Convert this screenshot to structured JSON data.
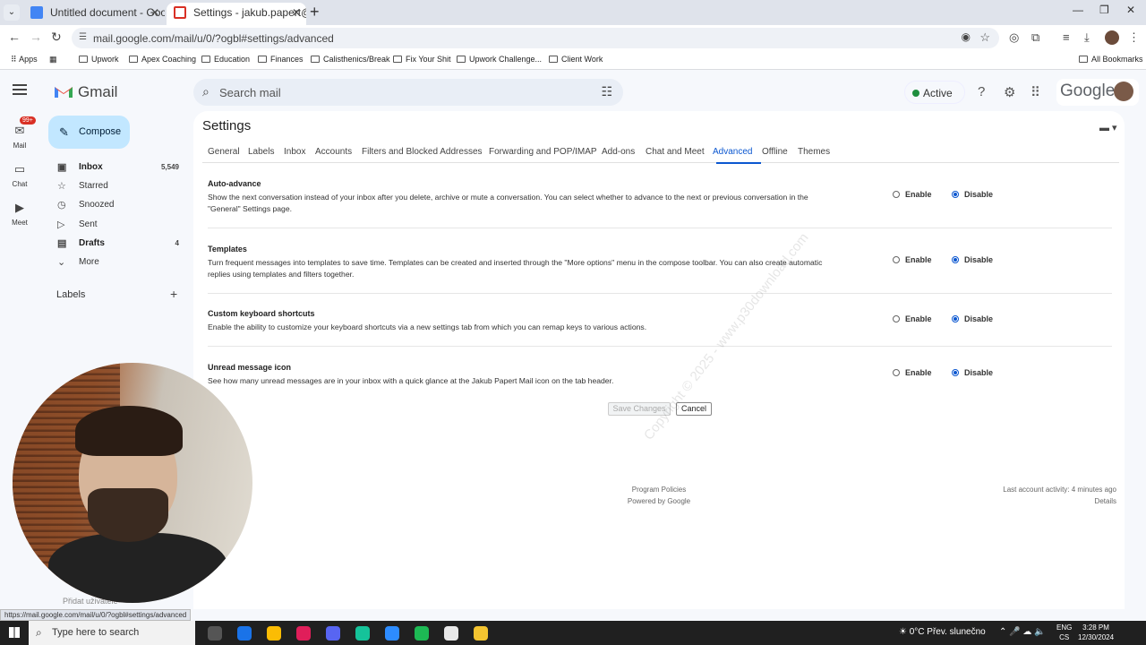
{
  "browser": {
    "tabs": [
      {
        "title": "Untitled document - Google Do"
      },
      {
        "title": "Settings - jakub.papert@jakew"
      }
    ],
    "url": "mail.google.com/mail/u/0/?ogbl#settings/advanced",
    "bookmarks": [
      "Apps",
      "Upwork",
      "Apex Coaching",
      "Education",
      "Finances",
      "Calisthenics/Break",
      "Fix Your Shit",
      "Upwork Challenge...",
      "Client Work"
    ],
    "all_bookmarks": "All Bookmarks",
    "status_url": "https://mail.google.com/mail/u/0/?ogbl#settings/advanced"
  },
  "gmail": {
    "product": "Gmail",
    "search_placeholder": "Search mail",
    "status": "Active",
    "google_word": "Google",
    "rail": [
      {
        "label": "Mail",
        "badge": "99+"
      },
      {
        "label": "Chat"
      },
      {
        "label": "Meet"
      }
    ],
    "compose": "Compose",
    "nav": [
      {
        "label": "Inbox",
        "count": "5,549",
        "icon": "inbox-icon"
      },
      {
        "label": "Starred",
        "count": "",
        "icon": "star-icon"
      },
      {
        "label": "Snoozed",
        "count": "",
        "icon": "clock-icon"
      },
      {
        "label": "Sent",
        "count": "",
        "icon": "send-icon"
      },
      {
        "label": "Drafts",
        "count": "4",
        "icon": "draft-icon"
      },
      {
        "label": "More",
        "count": "",
        "icon": "chevron-down-icon"
      }
    ],
    "labels_heading": "Labels",
    "add_user": "Přidat uživatele"
  },
  "settings": {
    "title": "Settings",
    "tabs": [
      "General",
      "Labels",
      "Inbox",
      "Accounts",
      "Filters and Blocked Addresses",
      "Forwarding and POP/IMAP",
      "Add-ons",
      "Chat and Meet",
      "Advanced",
      "Offline",
      "Themes"
    ],
    "selected_tab": "Advanced",
    "sections": [
      {
        "title": "Auto-advance",
        "desc": "Show the next conversation instead of your inbox after you delete, archive or mute a conversation. You can select whether to advance to the next or previous conversation in the \"General\" Settings page.",
        "value": "Disable"
      },
      {
        "title": "Templates",
        "desc": "Turn frequent messages into templates to save time. Templates can be created and inserted through the \"More options\" menu in the compose toolbar. You can also create automatic replies using templates and filters together.",
        "value": "Disable"
      },
      {
        "title": "Custom keyboard shortcuts",
        "desc": "Enable the ability to customize your keyboard shortcuts via a new settings tab from which you can remap keys to various actions.",
        "value": "Disable"
      },
      {
        "title": "Unread message icon",
        "desc": "See how many unread messages are in your inbox with a quick glance at the Jakub Papert Mail icon on the tab header.",
        "value": "Disable"
      }
    ],
    "enable_label": "Enable",
    "disable_label": "Disable",
    "save_label": "Save Changes",
    "cancel_label": "Cancel",
    "footer": {
      "policies": "Program Policies",
      "powered": "Powered by Google",
      "activity": "Last account activity: 4 minutes ago",
      "details": "Details"
    },
    "watermark": "Copyright © 2025 - www.p30download.com"
  },
  "taskbar": {
    "search_placeholder": "Type here to search",
    "weather": "0°C  Přev. slunečno",
    "lang_top": "ENG",
    "lang_bottom": "CS",
    "time": "3:28 PM",
    "date": "12/30/2024"
  }
}
